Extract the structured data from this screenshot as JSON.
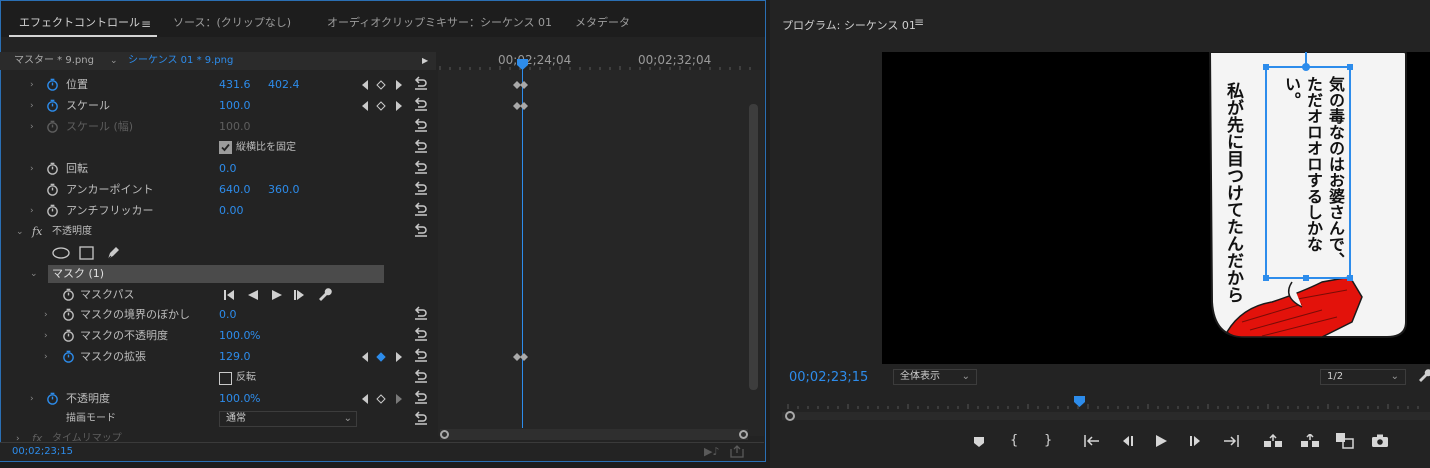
{
  "tabs": {
    "effect_controls": "エフェクトコントロール",
    "source": "ソース：(クリップなし)",
    "audio_mixer": "オーディオクリップミキサー：シーケンス 01",
    "metadata": "メタデータ"
  },
  "source_row": {
    "master": "マスター * 9.png",
    "sequence": "シーケンス 01 * 9.png"
  },
  "timeline": {
    "time_a": "00;02;24;04",
    "time_b": "00;02;32;04"
  },
  "properties": {
    "position": {
      "label": "位置",
      "x": "431.6",
      "y": "402.4"
    },
    "scale": {
      "label": "スケール",
      "value": "100.0"
    },
    "scale_width": {
      "label": "スケール (幅)",
      "value": "100.0"
    },
    "uniform_scale": {
      "label": "縦横比を固定",
      "checked": true
    },
    "rotation": {
      "label": "回転",
      "value": "0.0"
    },
    "anchor": {
      "label": "アンカーポイント",
      "x": "640.0",
      "y": "360.0"
    },
    "anti_flicker": {
      "label": "アンチフリッカー",
      "value": "0.00"
    },
    "opacity_section": {
      "label": "不透明度"
    },
    "mask": {
      "label": "マスク (1)"
    },
    "mask_path": {
      "label": "マスクパス"
    },
    "mask_feather": {
      "label": "マスクの境界のぼかし",
      "value": "0.0"
    },
    "mask_opacity": {
      "label": "マスクの不透明度",
      "value": "100.0",
      "unit": "%"
    },
    "mask_expansion": {
      "label": "マスクの拡張",
      "value": "129.0"
    },
    "inverted": {
      "label": "反転",
      "checked": false
    },
    "opacity": {
      "label": "不透明度",
      "value": "100.0",
      "unit": "%"
    },
    "blend_mode": {
      "label": "描画モード",
      "value": "通常"
    },
    "time_remap": {
      "label": "タイムリマップ"
    }
  },
  "bottom_time": "00;02;23;15",
  "program": {
    "title": "プログラム: シーケンス 01",
    "timecode": "00;02;23;15",
    "fit": "全体表示",
    "resolution": "1/2",
    "bubble_text_right": "気の毒なのはお婆さんで、ただオロオロするしかない。",
    "bubble_text_left": "私が先に目つけてたんだから"
  },
  "colors": {
    "accent": "#2d8ceb",
    "panel": "#232323",
    "frame": "#2a6fb4"
  }
}
